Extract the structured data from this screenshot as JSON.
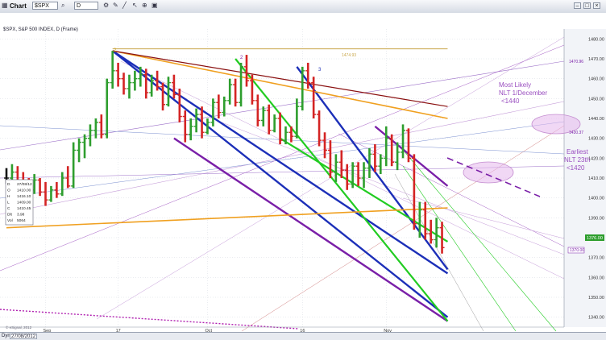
{
  "window": {
    "title": "Chart",
    "symbol": "$SPX",
    "interval": "D",
    "icons": [
      "chart-icon",
      "search-icon",
      "gear-icon",
      "pencil-icon",
      "line-tool-icon",
      "cursor-icon",
      "zoom-icon",
      "save-icon"
    ]
  },
  "header": {
    "info": "$SPX, S&P 500 INDEX, D (Frame)"
  },
  "ohlc_table": {
    "rows": [
      {
        "k": "D",
        "v": "27/08/12"
      },
      {
        "k": "O",
        "v": "1410.00"
      },
      {
        "k": "H",
        "v": "1416.10"
      },
      {
        "k": "L",
        "v": "1409.00"
      },
      {
        "k": "C",
        "v": "1410.45"
      },
      {
        "k": "Dlt",
        "v": "3.98"
      },
      {
        "k": "Vol",
        "v": "5064"
      }
    ]
  },
  "annotations": {
    "most_likely": [
      "Most Likely",
      "NLT 1/December",
      "<1440"
    ],
    "earliest": [
      "Earliest",
      "NLT 23th",
      "<1420"
    ],
    "price_tag_current": "1376.00",
    "price_tag_low": "1370.00",
    "top_label": "1474.93",
    "fib_label": "1470.96",
    "mid_label": "1430.37",
    "wave_marks": [
      "2",
      "2",
      "3"
    ]
  },
  "status": {
    "date": "27/08/2012",
    "prefix": "Dyn",
    "copyright": "© eSignal, 2012"
  },
  "colors": {
    "up": "#2e9e2e",
    "down": "#d42424",
    "neutral": "#111111",
    "blue_channel": "#1c2fb8",
    "purple_channel": "#7a1fa8",
    "green_channel": "#22cc22",
    "orange_line": "#f0a020"
  },
  "chart_data": {
    "type": "line",
    "subtype": "ohlc-bars",
    "title": "$SPX, S&P 500 INDEX, D (Frame)",
    "xlabel": "",
    "ylabel": "",
    "x_ticks": [
      "Sep",
      "17",
      "Oct",
      "16",
      "Nov"
    ],
    "y_ticks": [
      "1480.00",
      "1470.00",
      "1460.00",
      "1450.00",
      "1440.00",
      "1430.00",
      "1420.00",
      "1410.00",
      "1400.00",
      "1390.00",
      "1380.00",
      "1370.00",
      "1360.00",
      "1350.00",
      "1340.00"
    ],
    "ylim": [
      1335,
      1485
    ],
    "grid": true,
    "bars": [
      {
        "o": 1410,
        "h": 1415,
        "l": 1407,
        "c": 1410
      },
      {
        "o": 1410,
        "h": 1417,
        "l": 1406,
        "c": 1413
      },
      {
        "o": 1413,
        "h": 1416,
        "l": 1405,
        "c": 1408
      },
      {
        "o": 1408,
        "h": 1413,
        "l": 1404,
        "c": 1406
      },
      {
        "o": 1406,
        "h": 1410,
        "l": 1400,
        "c": 1404
      },
      {
        "o": 1404,
        "h": 1412,
        "l": 1402,
        "c": 1409
      },
      {
        "o": 1409,
        "h": 1410,
        "l": 1401,
        "c": 1403
      },
      {
        "o": 1403,
        "h": 1408,
        "l": 1396,
        "c": 1399
      },
      {
        "o": 1399,
        "h": 1406,
        "l": 1398,
        "c": 1404
      },
      {
        "o": 1404,
        "h": 1408,
        "l": 1400,
        "c": 1402
      },
      {
        "o": 1402,
        "h": 1413,
        "l": 1401,
        "c": 1410
      },
      {
        "o": 1410,
        "h": 1416,
        "l": 1405,
        "c": 1406
      },
      {
        "o": 1406,
        "h": 1428,
        "l": 1405,
        "c": 1424
      },
      {
        "o": 1424,
        "h": 1430,
        "l": 1418,
        "c": 1428
      },
      {
        "o": 1428,
        "h": 1432,
        "l": 1420,
        "c": 1430
      },
      {
        "o": 1430,
        "h": 1437,
        "l": 1426,
        "c": 1434
      },
      {
        "o": 1434,
        "h": 1440,
        "l": 1430,
        "c": 1438
      },
      {
        "o": 1438,
        "h": 1442,
        "l": 1430,
        "c": 1432
      },
      {
        "o": 1432,
        "h": 1460,
        "l": 1430,
        "c": 1458
      },
      {
        "o": 1458,
        "h": 1474,
        "l": 1455,
        "c": 1464
      },
      {
        "o": 1464,
        "h": 1468,
        "l": 1456,
        "c": 1460
      },
      {
        "o": 1460,
        "h": 1463,
        "l": 1452,
        "c": 1455
      },
      {
        "o": 1455,
        "h": 1462,
        "l": 1450,
        "c": 1458
      },
      {
        "o": 1458,
        "h": 1464,
        "l": 1454,
        "c": 1460
      },
      {
        "o": 1460,
        "h": 1466,
        "l": 1456,
        "c": 1462
      },
      {
        "o": 1462,
        "h": 1465,
        "l": 1450,
        "c": 1453
      },
      {
        "o": 1453,
        "h": 1462,
        "l": 1451,
        "c": 1459
      },
      {
        "o": 1459,
        "h": 1464,
        "l": 1454,
        "c": 1456
      },
      {
        "o": 1456,
        "h": 1458,
        "l": 1444,
        "c": 1447
      },
      {
        "o": 1447,
        "h": 1461,
        "l": 1446,
        "c": 1458
      },
      {
        "o": 1458,
        "h": 1462,
        "l": 1450,
        "c": 1452
      },
      {
        "o": 1452,
        "h": 1455,
        "l": 1438,
        "c": 1441
      },
      {
        "o": 1441,
        "h": 1444,
        "l": 1428,
        "c": 1432
      },
      {
        "o": 1432,
        "h": 1440,
        "l": 1429,
        "c": 1436
      },
      {
        "o": 1436,
        "h": 1445,
        "l": 1433,
        "c": 1442
      },
      {
        "o": 1442,
        "h": 1446,
        "l": 1430,
        "c": 1433
      },
      {
        "o": 1433,
        "h": 1440,
        "l": 1432,
        "c": 1438
      },
      {
        "o": 1438,
        "h": 1450,
        "l": 1436,
        "c": 1448
      },
      {
        "o": 1448,
        "h": 1452,
        "l": 1440,
        "c": 1443
      },
      {
        "o": 1443,
        "h": 1451,
        "l": 1441,
        "c": 1449
      },
      {
        "o": 1449,
        "h": 1460,
        "l": 1447,
        "c": 1457
      },
      {
        "o": 1457,
        "h": 1460,
        "l": 1446,
        "c": 1448
      },
      {
        "o": 1448,
        "h": 1468,
        "l": 1446,
        "c": 1466
      },
      {
        "o": 1466,
        "h": 1472,
        "l": 1456,
        "c": 1459
      },
      {
        "o": 1459,
        "h": 1462,
        "l": 1447,
        "c": 1449
      },
      {
        "o": 1449,
        "h": 1452,
        "l": 1436,
        "c": 1439
      },
      {
        "o": 1439,
        "h": 1446,
        "l": 1436,
        "c": 1444
      },
      {
        "o": 1444,
        "h": 1447,
        "l": 1432,
        "c": 1434
      },
      {
        "o": 1434,
        "h": 1442,
        "l": 1433,
        "c": 1440
      },
      {
        "o": 1440,
        "h": 1443,
        "l": 1427,
        "c": 1429
      },
      {
        "o": 1429,
        "h": 1436,
        "l": 1427,
        "c": 1433
      },
      {
        "o": 1433,
        "h": 1436,
        "l": 1428,
        "c": 1431
      },
      {
        "o": 1431,
        "h": 1450,
        "l": 1430,
        "c": 1446
      },
      {
        "o": 1446,
        "h": 1466,
        "l": 1444,
        "c": 1464
      },
      {
        "o": 1464,
        "h": 1468,
        "l": 1455,
        "c": 1458
      },
      {
        "o": 1458,
        "h": 1461,
        "l": 1440,
        "c": 1442
      },
      {
        "o": 1442,
        "h": 1444,
        "l": 1426,
        "c": 1429
      },
      {
        "o": 1429,
        "h": 1433,
        "l": 1420,
        "c": 1424
      },
      {
        "o": 1424,
        "h": 1429,
        "l": 1410,
        "c": 1413
      },
      {
        "o": 1413,
        "h": 1422,
        "l": 1408,
        "c": 1418
      },
      {
        "o": 1418,
        "h": 1424,
        "l": 1410,
        "c": 1414
      },
      {
        "o": 1414,
        "h": 1417,
        "l": 1404,
        "c": 1407
      },
      {
        "o": 1407,
        "h": 1418,
        "l": 1405,
        "c": 1416
      },
      {
        "o": 1416,
        "h": 1418,
        "l": 1406,
        "c": 1410
      },
      {
        "o": 1410,
        "h": 1418,
        "l": 1405,
        "c": 1415
      },
      {
        "o": 1415,
        "h": 1425,
        "l": 1410,
        "c": 1422
      },
      {
        "o": 1422,
        "h": 1427,
        "l": 1413,
        "c": 1416
      },
      {
        "o": 1416,
        "h": 1422,
        "l": 1412,
        "c": 1420
      },
      {
        "o": 1420,
        "h": 1436,
        "l": 1416,
        "c": 1430
      },
      {
        "o": 1430,
        "h": 1432,
        "l": 1416,
        "c": 1418
      },
      {
        "o": 1418,
        "h": 1428,
        "l": 1414,
        "c": 1423
      },
      {
        "o": 1423,
        "h": 1437,
        "l": 1420,
        "c": 1434
      },
      {
        "o": 1434,
        "h": 1435,
        "l": 1418,
        "c": 1420
      },
      {
        "o": 1420,
        "h": 1422,
        "l": 1384,
        "c": 1387
      },
      {
        "o": 1387,
        "h": 1398,
        "l": 1380,
        "c": 1394
      },
      {
        "o": 1394,
        "h": 1398,
        "l": 1379,
        "c": 1382
      },
      {
        "o": 1382,
        "h": 1389,
        "l": 1377,
        "c": 1379
      },
      {
        "o": 1379,
        "h": 1390,
        "l": 1375,
        "c": 1385
      },
      {
        "o": 1385,
        "h": 1388,
        "l": 1372,
        "c": 1375
      }
    ],
    "lines": [
      {
        "name": "",
        "color": "#1c2fb8",
        "width": 2.4,
        "x1": 19,
        "y1": 1474,
        "x2": 79,
        "y2": 1340
      },
      {
        "name": "",
        "color": "#1c2fb8",
        "width": 2.4,
        "x1": 19,
        "y1": 1474,
        "x2": 79,
        "y2": 1362
      },
      {
        "name": "",
        "color": "#1c2fb8",
        "width": 2.4,
        "x1": 52,
        "y1": 1466,
        "x2": 79,
        "y2": 1364
      },
      {
        "name": "",
        "color": "#7a1fa8",
        "width": 2.4,
        "x1": 30,
        "y1": 1430,
        "x2": 79,
        "y2": 1338
      },
      {
        "name": "",
        "color": "#7a1fa8",
        "width": 2.4,
        "x1": 66,
        "y1": 1436,
        "x2": 79,
        "y2": 1406
      },
      {
        "name": "",
        "color": "#22cc22",
        "width": 2.2,
        "x1": 41,
        "y1": 1470,
        "x2": 79,
        "y2": 1338
      },
      {
        "name": "",
        "color": "#22cc22",
        "width": 2.2,
        "x1": 49,
        "y1": 1430,
        "x2": 79,
        "y2": 1378
      },
      {
        "name": "",
        "color": "#f0a020",
        "width": 1.6,
        "x1": 0,
        "y1": 1385,
        "x2": 79,
        "y2": 1395
      },
      {
        "name": "",
        "color": "#f0a020",
        "width": 1.6,
        "x1": 19,
        "y1": 1474,
        "x2": 79,
        "y2": 1440
      },
      {
        "name": "",
        "color": "#8a1010",
        "width": 1.2,
        "x1": 19,
        "y1": 1474,
        "x2": 79,
        "y2": 1446
      },
      {
        "name": "",
        "color": "#c8a64a",
        "width": 1,
        "x1": 19,
        "y1": 1475,
        "x2": 79,
        "y2": 1475
      }
    ]
  }
}
